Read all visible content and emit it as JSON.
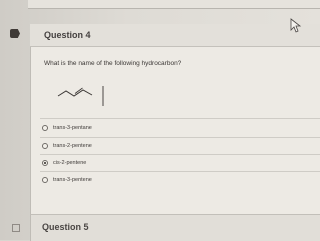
{
  "question4": {
    "title": "Question 4",
    "prompt": "What is the name of the following hydrocarbon?",
    "options": [
      {
        "label": "trans-3-pentane",
        "checked": false
      },
      {
        "label": "trans-2-pentene",
        "checked": false
      },
      {
        "label": "cis-2-pentene",
        "checked": true
      },
      {
        "label": "trans-3-pentene",
        "checked": false
      }
    ],
    "selected_label": "cis-2-pentene"
  },
  "question5": {
    "title": "Question 5"
  },
  "icons": {
    "flag": "flag-icon",
    "cursor": "mouse-cursor-icon",
    "molecule": "skeletal-structure-diagram"
  },
  "colors": {
    "page_background": "#dedbd5",
    "card_background": "#edeae4",
    "text": "#3f3b39"
  }
}
